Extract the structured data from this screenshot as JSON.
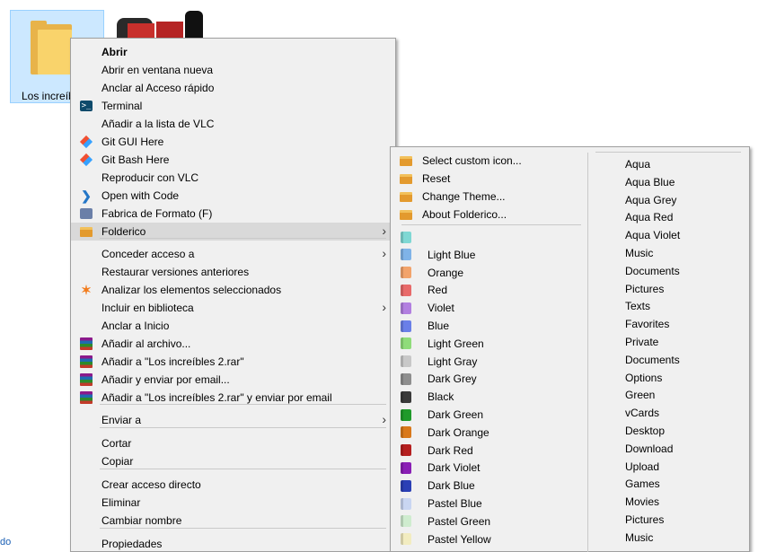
{
  "desktop": {
    "folder_label": "Los increíbles",
    "left_edge_text": "do"
  },
  "context_menu": {
    "items": [
      {
        "label": "Abrir",
        "icon": "none",
        "bold": true
      },
      {
        "label": "Abrir en ventana nueva",
        "icon": "none"
      },
      {
        "label": "Anclar al Acceso rápido",
        "icon": "none"
      },
      {
        "label": "Terminal",
        "icon": "terminal-icon"
      },
      {
        "label": "Añadir a la lista de VLC",
        "icon": "none"
      },
      {
        "label": "Git GUI Here",
        "icon": "git-icon"
      },
      {
        "label": "Git Bash Here",
        "icon": "git-icon"
      },
      {
        "label": "Reproducir con VLC",
        "icon": "none"
      },
      {
        "label": "Open with Code",
        "icon": "vscode-icon"
      },
      {
        "label": "Fabrica de Formato (F)",
        "icon": "format-factory-icon"
      },
      {
        "label": "Folderico",
        "icon": "folderico-icon",
        "submenu": true,
        "highlighted": true
      },
      {
        "label": "Conceder acceso a",
        "icon": "none",
        "submenu": true
      },
      {
        "label": "Restaurar versiones anteriores",
        "icon": "none"
      },
      {
        "label": "Analizar los elementos seleccionados",
        "icon": "avast-icon"
      },
      {
        "label": "Incluir en biblioteca",
        "icon": "none",
        "submenu": true
      },
      {
        "label": "Anclar a Inicio",
        "icon": "none"
      },
      {
        "label": "Añadir al archivo...",
        "icon": "winrar-icon"
      },
      {
        "label": "Añadir a \"Los increíbles 2.rar\"",
        "icon": "winrar-icon"
      },
      {
        "label": "Añadir y enviar por email...",
        "icon": "winrar-icon"
      },
      {
        "label": "Añadir a \"Los increíbles 2.rar\" y enviar por email",
        "icon": "winrar-icon"
      },
      {
        "label": "Enviar a",
        "icon": "none",
        "submenu": true
      },
      {
        "label": "Cortar",
        "icon": "none"
      },
      {
        "label": "Copiar",
        "icon": "none"
      },
      {
        "label": "Crear acceso directo",
        "icon": "none"
      },
      {
        "label": "Eliminar",
        "icon": "none"
      },
      {
        "label": "Cambiar nombre",
        "icon": "none"
      },
      {
        "label": "Propiedades",
        "icon": "none"
      }
    ]
  },
  "folderico_menu": {
    "actions": [
      {
        "label": "Select custom icon..."
      },
      {
        "label": "Reset"
      },
      {
        "label": "Change Theme..."
      },
      {
        "label": "About Folderico..."
      }
    ],
    "colors": [
      {
        "label": "",
        "color": "#7fd8d4"
      },
      {
        "label": "Light Blue",
        "color": "#7fb3e8"
      },
      {
        "label": "Orange",
        "color": "#f2a36b"
      },
      {
        "label": "Red",
        "color": "#e86a6a"
      },
      {
        "label": "Violet",
        "color": "#b27fe0"
      },
      {
        "label": "Blue",
        "color": "#6a7fe8"
      },
      {
        "label": "Light Green",
        "color": "#8fdc7a"
      },
      {
        "label": "Light Gray",
        "color": "#c8c8c8"
      },
      {
        "label": "Dark Grey",
        "color": "#8e8e8e"
      },
      {
        "label": "Black",
        "color": "#3a3a3a"
      },
      {
        "label": "Dark Green",
        "color": "#1f9a2a"
      },
      {
        "label": "Dark Orange",
        "color": "#d9781a"
      },
      {
        "label": "Dark Red",
        "color": "#b51f1f"
      },
      {
        "label": "Dark Violet",
        "color": "#8a1fb5"
      },
      {
        "label": "Dark Blue",
        "color": "#2a3fb5"
      },
      {
        "label": "Pastel Blue",
        "color": "#c9d6f2"
      },
      {
        "label": "Pastel Green",
        "color": "#cfeccf"
      },
      {
        "label": "Pastel Yellow",
        "color": "#f2ecc0"
      }
    ],
    "themes": [
      "Aqua",
      "Aqua Blue",
      "Aqua Grey",
      "Aqua Red",
      "Aqua Violet",
      "Music",
      "Documents",
      "Pictures",
      "Texts",
      "Favorites",
      "Private",
      "Documents",
      "Options",
      "Green",
      "vCards",
      "Desktop",
      "Download",
      "Upload",
      "Games",
      "Movies",
      "Pictures",
      "Music"
    ]
  }
}
